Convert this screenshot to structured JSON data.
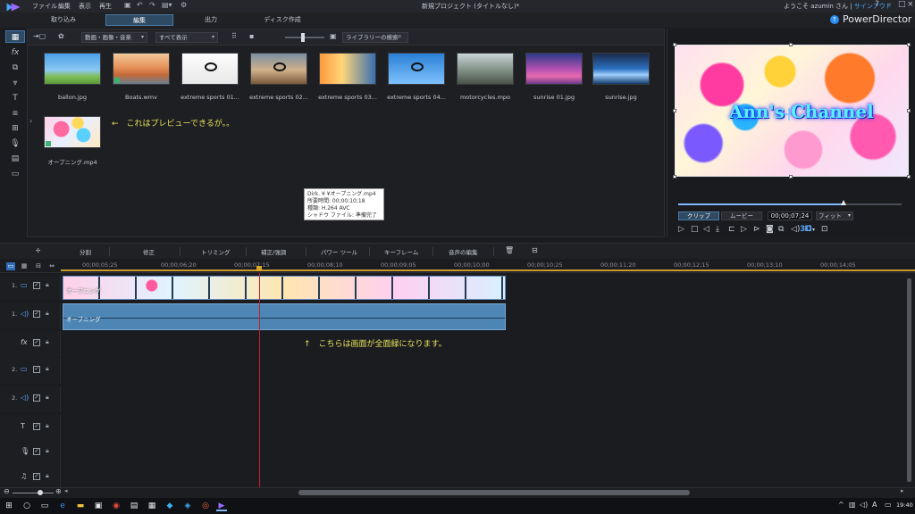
{
  "menu": {
    "items": [
      "ファイル",
      "編集",
      "表示",
      "再生"
    ],
    "window_title": "新規プロジェクト (タイトルなし)*",
    "welcome": "ようこそ azumin さん",
    "signout": "サインアウト"
  },
  "modes": {
    "tabs": [
      "取り込み",
      "編集",
      "出力",
      "ディスク作成"
    ],
    "active": "編集",
    "brand": "PowerDirector"
  },
  "library": {
    "filter": "動画・画像・音楽",
    "view": "すべて表示",
    "search_placeholder": "ライブラリーの検索",
    "items": [
      {
        "name": "ballon.jpg",
        "thumb": "t-balloon"
      },
      {
        "name": "Boats.wmv",
        "thumb": "t-boats"
      },
      {
        "name": "extreme sports 01...",
        "thumb": "t-bmx"
      },
      {
        "name": "extreme sports 02...",
        "thumb": "t-moto"
      },
      {
        "name": "extreme sports 03...",
        "thumb": "t-sunset"
      },
      {
        "name": "extreme sports 04...",
        "thumb": "t-sky"
      },
      {
        "name": "motorcycles.mpo",
        "thumb": "t-bikes"
      },
      {
        "name": "sunrise 01.jpg",
        "thumb": "t-sunrise1"
      },
      {
        "name": "sunrise.jpg",
        "thumb": "t-sunrise"
      },
      {
        "name": "オープニング.mp4",
        "thumb": "t-opening"
      }
    ],
    "note_preview": "←　これはプレビューできるが。。",
    "tooltip": {
      "line1": "Dirk.    ¥    ¥オープニング.mp4",
      "line2": "所要時間: 00;00;10;18",
      "line3": "種類: H.264 AVC",
      "line4": "シャドウ ファイル: 準備完了"
    }
  },
  "preview": {
    "overlay_text": "Ann's Channel",
    "tab_clip": "クリップ",
    "tab_movie": "ムービー",
    "timecode": "00;00;07;24",
    "fit": "フィット",
    "scrub_position": 0.74,
    "three_d": "3D"
  },
  "edit_toolbar": {
    "items": [
      "分割",
      "修正",
      "トリミング",
      "補正/強調",
      "パワー ツール",
      "キーフレーム",
      "音声の編集"
    ]
  },
  "timeline": {
    "ticks": [
      "00;00;05;25",
      "00;00;06;20",
      "00;00;07;15",
      "00;00;08;10",
      "00;00;09;05",
      "00;00;10;00",
      "00;00;10;25",
      "00;00;11;20",
      "00;00;12;15",
      "00;00;13;10",
      "00;00;14;05"
    ],
    "tracks": [
      {
        "num": "1.",
        "icon": "video-icon"
      },
      {
        "num": "1.",
        "icon": "audio-icon"
      },
      {
        "num": "",
        "icon": "fx-icon"
      },
      {
        "num": "2.",
        "icon": "video-icon"
      },
      {
        "num": "2.",
        "icon": "audio-icon"
      },
      {
        "num": "",
        "icon": "title-icon"
      },
      {
        "num": "",
        "icon": "voice-icon"
      },
      {
        "num": "",
        "icon": "music-icon"
      }
    ],
    "video_clip_label": "オープニング",
    "audio_clip_label": "オープニング",
    "note_fullgreen": "↑　こちらは画面が全面緑になります。"
  },
  "taskbar": {
    "time": "19:40"
  }
}
